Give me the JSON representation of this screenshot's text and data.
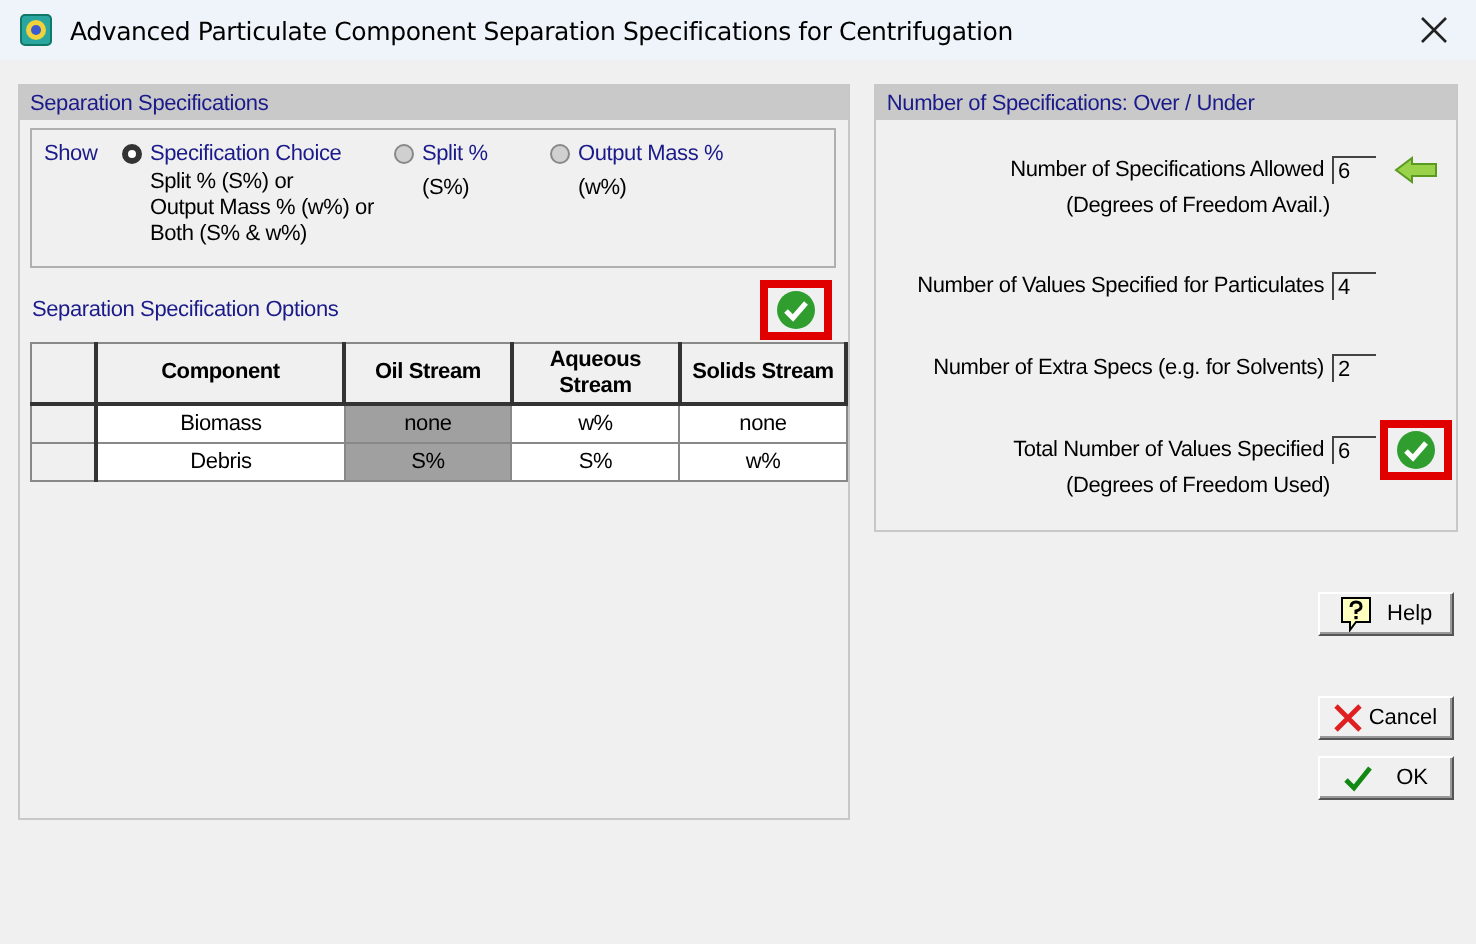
{
  "window": {
    "title": "Advanced Particulate Component Separation Specifications for Centrifugation"
  },
  "separation": {
    "title": "Separation Specifications",
    "show_label": "Show",
    "options": [
      {
        "label": "Specification Choice",
        "description": [
          "Split % (S%)  or",
          "Output Mass % (w%)  or",
          "Both (S% & w%)"
        ],
        "selected": true
      },
      {
        "label": "Split %",
        "description": [
          "(S%)"
        ],
        "selected": false
      },
      {
        "label": "Output Mass %",
        "description": [
          "(w%)"
        ],
        "selected": false
      }
    ],
    "options_title": "Separation Specification Options",
    "status": {
      "kind": "ok",
      "highlighted": true
    },
    "table": {
      "columns": [
        {
          "label": "Component",
          "disabled": false
        },
        {
          "label": "Oil Stream",
          "disabled": true
        },
        {
          "label": "Aqueous Stream",
          "disabled": false
        },
        {
          "label": "Solids Stream",
          "disabled": false
        }
      ],
      "rows": [
        [
          "Biomass",
          "none",
          "w%",
          "none"
        ],
        [
          "Debris",
          "S%",
          "S%",
          "w%"
        ]
      ]
    }
  },
  "counts": {
    "title": "Number of Specifications: Over / Under",
    "rows": [
      {
        "label": "Number of Specifications Allowed",
        "note": "(Degrees of Freedom Avail.)",
        "value": "6",
        "marker": {
          "kind": "arrow"
        }
      },
      {
        "label": "Number of Values Specified for Particulates",
        "value": "4"
      },
      {
        "label": "Number of Extra Specs (e.g. for Solvents)",
        "value": "2"
      },
      {
        "label": "Total Number of Values Specified",
        "note": "(Degrees of Freedom Used)",
        "value": "6",
        "marker": {
          "kind": "ok",
          "highlighted": true
        }
      }
    ]
  },
  "buttons": [
    {
      "kind": "help",
      "label": "Help"
    },
    {
      "kind": "cancel",
      "label": "Cancel"
    },
    {
      "kind": "ok",
      "label": "OK"
    }
  ]
}
